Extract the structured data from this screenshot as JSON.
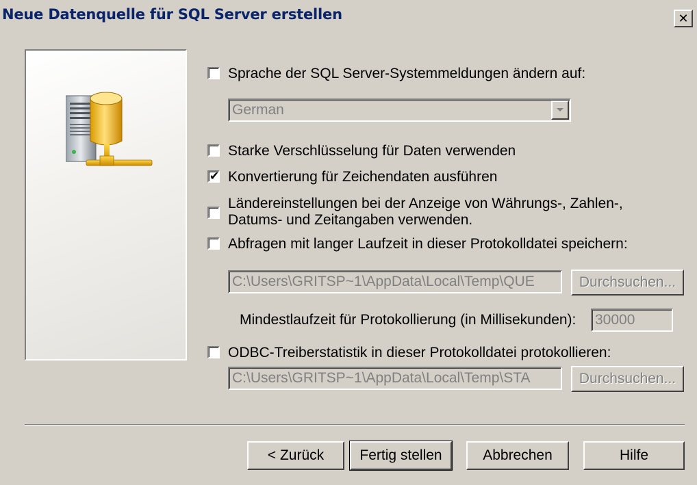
{
  "window": {
    "title": "Neue Datenquelle für SQL Server erstellen",
    "close_glyph": "✕"
  },
  "options": {
    "language": {
      "label": "Sprache der SQL Server-Systemmeldungen ändern auf:",
      "checked": false
    },
    "language_select": {
      "value": "German"
    },
    "encryption": {
      "label": "Starke Verschlüsselung für Daten verwenden",
      "checked": false
    },
    "convert": {
      "label": "Konvertierung für Zeichendaten ausführen",
      "checked": true
    },
    "regional": {
      "line1": "Ländereinstellungen bei der Anzeige von Währungs-, Zahlen-,",
      "line2": "Datums- und Zeitangaben verwenden.",
      "checked": false
    },
    "long_queries": {
      "label": "Abfragen mit langer Laufzeit in dieser Protokolldatei speichern:",
      "checked": false
    },
    "long_queries_path": "C:\\Users\\GRITSP~1\\AppData\\Local\\Temp\\QUE",
    "browse1": "Durchsuchen...",
    "min_runtime_label": "Mindestlaufzeit für Protokollierung (in Millisekunden):",
    "min_runtime_value": "30000",
    "driver_stats": {
      "label": "ODBC-Treiberstatistik in dieser Protokolldatei protokollieren:",
      "checked": false
    },
    "driver_stats_path": "C:\\Users\\GRITSP~1\\AppData\\Local\\Temp\\STA",
    "browse2": "Durchsuchen..."
  },
  "buttons": {
    "back": "< Zurück",
    "finish": "Fertig stellen",
    "cancel": "Abbrechen",
    "help": "Hilfe"
  },
  "icons": {
    "side": "database-server-icon",
    "check": "checkmark-icon",
    "dropdown": "chevron-down-icon"
  },
  "colors": {
    "title": "#0a246a",
    "face": "#d4d0c8",
    "disabled_text": "#808080"
  }
}
